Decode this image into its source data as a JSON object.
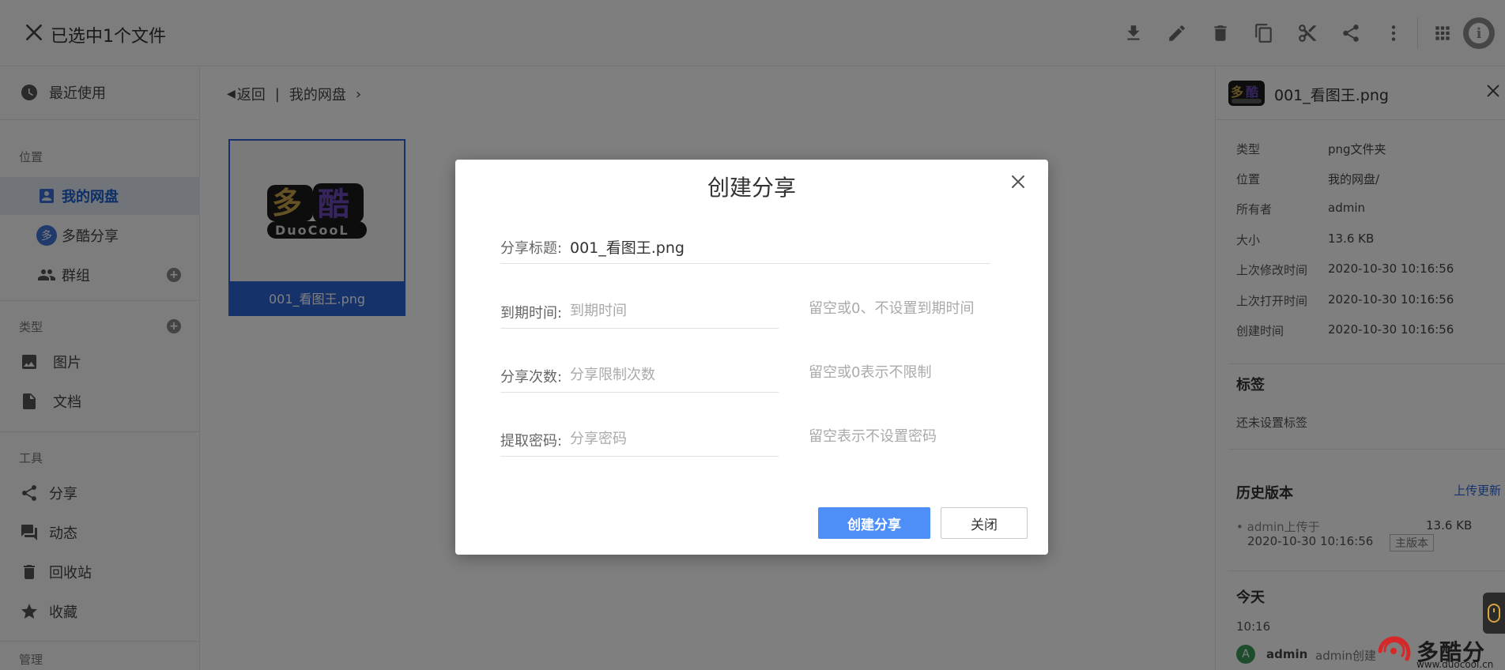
{
  "topbar": {
    "title": "已选中1个文件",
    "actions": [
      "download-icon",
      "edit-icon",
      "delete-icon",
      "copy-icon",
      "cut-icon",
      "share-icon",
      "more-icon",
      "grid-view-icon",
      "info-icon"
    ]
  },
  "sidebar": {
    "recent": "最近使用",
    "section_location": "位置",
    "my_drive": "我的网盘",
    "duocool_share": "多酷分享",
    "duocool_avatar": "多",
    "groups": "群组",
    "section_type": "类型",
    "images": "图片",
    "docs": "文档",
    "section_tools": "工具",
    "share": "分享",
    "activity": "动态",
    "trash": "回收站",
    "favorites": "收藏",
    "section_admin": "管理"
  },
  "main": {
    "back": "返回",
    "separator": "|",
    "drive": "我的网盘",
    "file_name": "001_看图王.png"
  },
  "details": {
    "title": "001_看图王.png",
    "props": [
      {
        "k": "类型",
        "v": "png文件夹"
      },
      {
        "k": "位置",
        "v": "我的网盘/"
      },
      {
        "k": "所有者",
        "v": "admin"
      },
      {
        "k": "大小",
        "v": "13.6 KB"
      },
      {
        "k": "上次修改时间",
        "v": "2020-10-30 10:16:56"
      },
      {
        "k": "上次打开时间",
        "v": "2020-10-30 10:16:56"
      },
      {
        "k": "创建时间",
        "v": "2020-10-30 10:16:56"
      }
    ],
    "tags_title": "标签",
    "tags_empty": "还未设置标签",
    "history_title": "历史版本",
    "upload_update": "上传更新",
    "version_uploader": "admin上传于",
    "version_size": "13.6 KB",
    "version_time": "2020-10-30 10:16:56",
    "version_tag": "主版本",
    "today_title": "今天",
    "today_time": "10:16",
    "activity_avatar": "A",
    "activity_user": "admin",
    "activity_text": "admin创建"
  },
  "dialog": {
    "title": "创建分享",
    "share_title_label": "分享标题:",
    "share_title_value": "001_看图王.png",
    "expire_label": "到期时间:",
    "expire_placeholder": "到期时间",
    "expire_hint": "留空或0、不设置到期时间",
    "count_label": "分享次数:",
    "count_placeholder": "分享限制次数",
    "count_hint": "留空或0表示不限制",
    "password_label": "提取密码:",
    "password_placeholder": "分享密码",
    "password_hint": "留空表示不设置密码",
    "create_button": "创建分享",
    "close_button": "关闭"
  },
  "watermark": {
    "brand": "多酷分享",
    "url": "www.duocool.cn"
  },
  "colors": {
    "accent": "#2d64d6",
    "primary_button": "#4d8ff7"
  }
}
